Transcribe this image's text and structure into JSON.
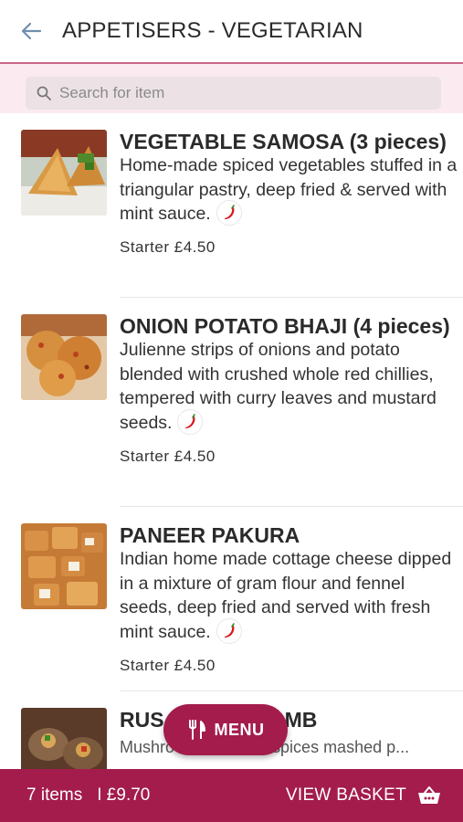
{
  "header": {
    "title": "APPETISERS - VEGETARIAN"
  },
  "search": {
    "placeholder": "Search for item"
  },
  "items": [
    {
      "name": "VEGETABLE SAMOSA (3 pieces)",
      "description": "Home-made spiced vegetables stuffed in a triangular pastry, deep fried & served with mint sauce.",
      "price": "Starter £4.50",
      "spicy_icon": "chili-icon"
    },
    {
      "name": "ONION POTATO BHAJI (4 pieces)",
      "description": "Julienne strips of onions and potato blended with crushed whole red chillies, tempered with curry leaves and mustard seeds.",
      "price": "Starter £4.50",
      "spicy_icon": "chili-icon"
    },
    {
      "name": "PANEER PAKURA",
      "description": "Indian home made cottage cheese dipped in a mixture of gram flour and fennel seeds, deep fried and served with fresh mint sauce.",
      "price": "Starter £4.50",
      "spicy_icon": "chili-icon"
    },
    {
      "name_left": "RUS",
      "name_right": "MB",
      "description_left": "Mushro",
      "description_right": "with spices mashed p..."
    }
  ],
  "menu_button": {
    "label": "MENU"
  },
  "basket": {
    "items_count": "7 items",
    "total": "I £9.70",
    "view_label": "VIEW BASKET"
  },
  "colors": {
    "brand": "#a31c4c",
    "search_bg": "#fbeaf0",
    "chili": "#d8161c"
  }
}
